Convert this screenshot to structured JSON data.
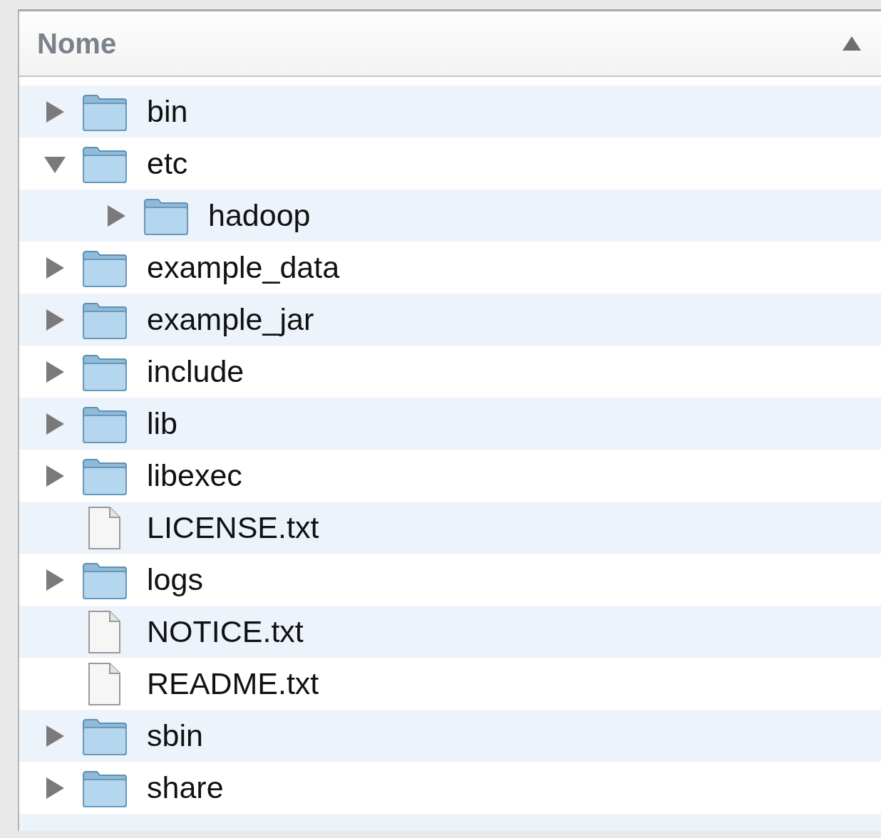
{
  "header": {
    "label": "Nome",
    "ascending": true
  },
  "tree": [
    {
      "name": "bin",
      "kind": "folder",
      "expanded": false
    },
    {
      "name": "etc",
      "kind": "folder",
      "expanded": true,
      "children": [
        {
          "name": "hadoop",
          "kind": "folder",
          "expanded": false
        }
      ]
    },
    {
      "name": "example_data",
      "kind": "folder",
      "expanded": false
    },
    {
      "name": "example_jar",
      "kind": "folder",
      "expanded": false
    },
    {
      "name": "include",
      "kind": "folder",
      "expanded": false
    },
    {
      "name": "lib",
      "kind": "folder",
      "expanded": false
    },
    {
      "name": "libexec",
      "kind": "folder",
      "expanded": false
    },
    {
      "name": "LICENSE.txt",
      "kind": "file"
    },
    {
      "name": "logs",
      "kind": "folder",
      "expanded": false
    },
    {
      "name": "NOTICE.txt",
      "kind": "file"
    },
    {
      "name": "README.txt",
      "kind": "file"
    },
    {
      "name": "sbin",
      "kind": "folder",
      "expanded": false
    },
    {
      "name": "share",
      "kind": "folder",
      "expanded": false
    }
  ]
}
